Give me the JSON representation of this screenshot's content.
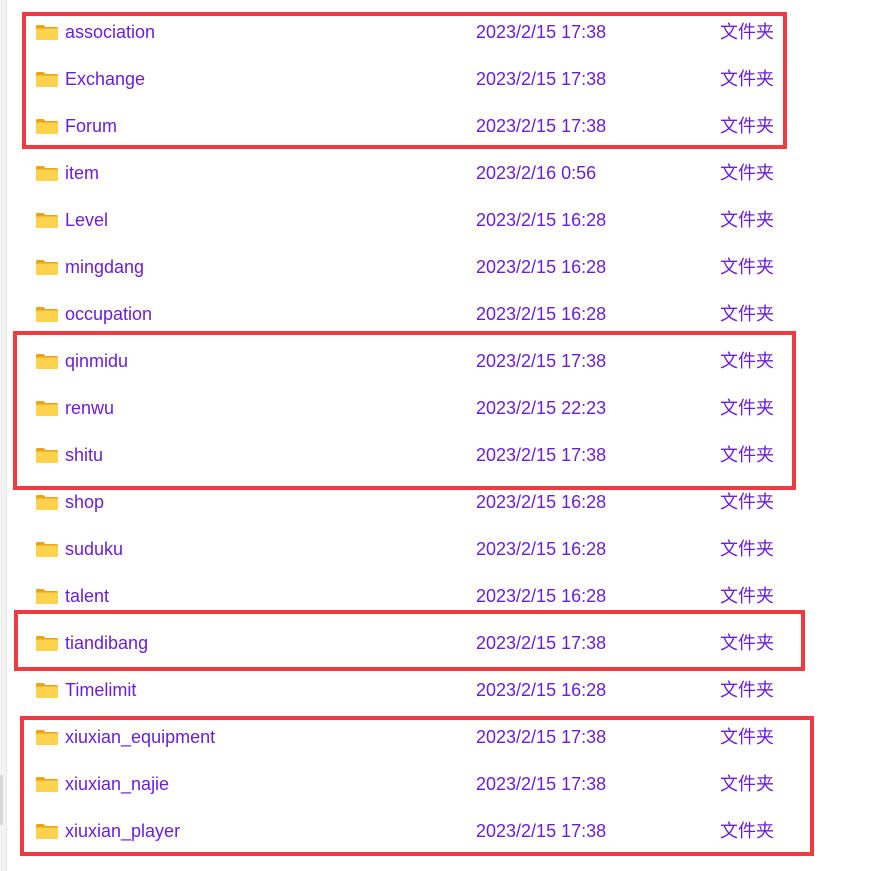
{
  "explorer": {
    "type_label": "文件夹",
    "accent_color": "#6a1fd6",
    "highlight_color": "#ef3b40",
    "folders": [
      {
        "name": "association",
        "modified": "2023/2/15 17:38",
        "type": "文件夹",
        "icon": "folder-icon",
        "highlighted": true
      },
      {
        "name": "Exchange",
        "modified": "2023/2/15 17:38",
        "type": "文件夹",
        "icon": "folder-icon",
        "highlighted": true
      },
      {
        "name": "Forum",
        "modified": "2023/2/15 17:38",
        "type": "文件夹",
        "icon": "folder-icon",
        "highlighted": true
      },
      {
        "name": "item",
        "modified": "2023/2/16 0:56",
        "type": "文件夹",
        "icon": "folder-icon",
        "highlighted": false
      },
      {
        "name": "Level",
        "modified": "2023/2/15 16:28",
        "type": "文件夹",
        "icon": "folder-icon",
        "highlighted": false
      },
      {
        "name": "mingdang",
        "modified": "2023/2/15 16:28",
        "type": "文件夹",
        "icon": "folder-icon",
        "highlighted": false
      },
      {
        "name": "occupation",
        "modified": "2023/2/15 16:28",
        "type": "文件夹",
        "icon": "folder-icon",
        "highlighted": false
      },
      {
        "name": "qinmidu",
        "modified": "2023/2/15 17:38",
        "type": "文件夹",
        "icon": "folder-icon",
        "highlighted": true
      },
      {
        "name": "renwu",
        "modified": "2023/2/15 22:23",
        "type": "文件夹",
        "icon": "folder-icon",
        "highlighted": true
      },
      {
        "name": "shitu",
        "modified": "2023/2/15 17:38",
        "type": "文件夹",
        "icon": "folder-icon",
        "highlighted": true
      },
      {
        "name": "shop",
        "modified": "2023/2/15 16:28",
        "type": "文件夹",
        "icon": "folder-icon",
        "highlighted": false
      },
      {
        "name": "suduku",
        "modified": "2023/2/15 16:28",
        "type": "文件夹",
        "icon": "folder-icon",
        "highlighted": false
      },
      {
        "name": "talent",
        "modified": "2023/2/15 16:28",
        "type": "文件夹",
        "icon": "folder-icon",
        "highlighted": false
      },
      {
        "name": "tiandibang",
        "modified": "2023/2/15 17:38",
        "type": "文件夹",
        "icon": "folder-icon",
        "highlighted": true
      },
      {
        "name": "Timelimit",
        "modified": "2023/2/15 16:28",
        "type": "文件夹",
        "icon": "folder-icon",
        "highlighted": false
      },
      {
        "name": "xiuxian_equipment",
        "modified": "2023/2/15 17:38",
        "type": "文件夹",
        "icon": "folder-icon",
        "highlighted": true
      },
      {
        "name": "xiuxian_najie",
        "modified": "2023/2/15 17:38",
        "type": "文件夹",
        "icon": "folder-icon",
        "highlighted": true
      },
      {
        "name": "xiuxian_player",
        "modified": "2023/2/15 17:38",
        "type": "文件夹",
        "icon": "folder-icon",
        "highlighted": true
      }
    ]
  }
}
